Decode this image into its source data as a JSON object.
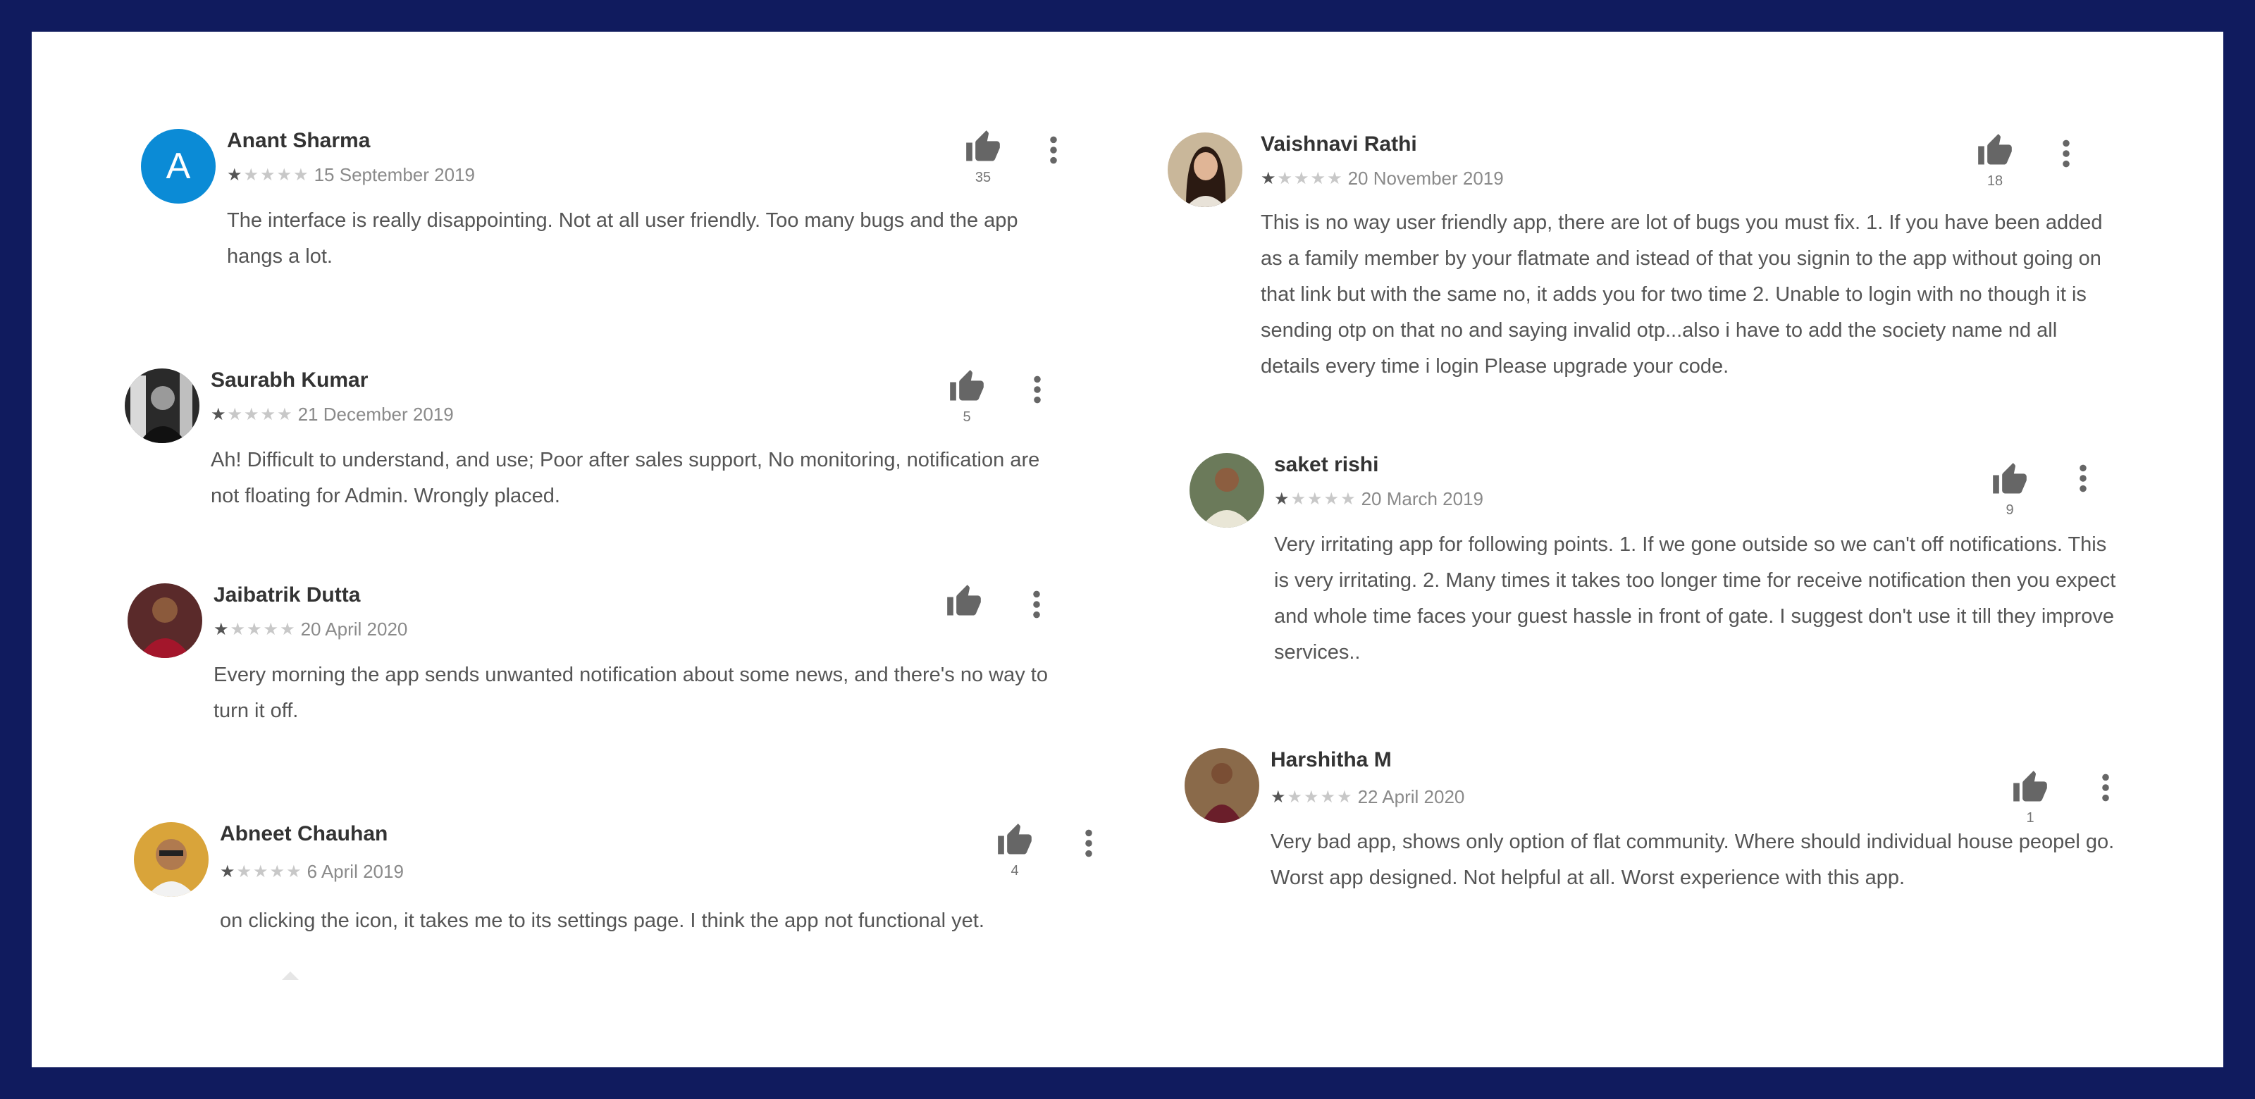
{
  "icons": {
    "like": "thumb-up-icon",
    "more": "more-vertical-icon",
    "star": "star-icon"
  },
  "colors": {
    "frame": "#101b5e",
    "avatar_initial_bg": "#0b8bd6",
    "star_filled": "#555555",
    "star_empty": "#c8c8c8"
  },
  "reviews": [
    {
      "author": "Anant Sharma",
      "avatar_initial": "A",
      "rating": 1,
      "stars_text": {
        "filled": "★",
        "empty": "★★★★"
      },
      "date": "15 September 2019",
      "text": "The interface is really disappointing. Not at all user friendly. Too many bugs and the app hangs a lot.",
      "likes": "35"
    },
    {
      "author": "Saurabh Kumar",
      "rating": 1,
      "stars_text": {
        "filled": "★",
        "empty": "★★★★"
      },
      "date": "21 December 2019",
      "text": "Ah! Difficult to understand, and use; Poor after sales support, No monitoring, notification are not floating for Admin. Wrongly placed.",
      "likes": "5"
    },
    {
      "author": "Jaibatrik Dutta",
      "rating": 1,
      "stars_text": {
        "filled": "★",
        "empty": "★★★★"
      },
      "date": "20 April 2020",
      "text": "Every morning the app sends unwanted notification about some news, and there's no way to turn it off.",
      "likes": ""
    },
    {
      "author": "Abneet Chauhan",
      "rating": 1,
      "stars_text": {
        "filled": "★",
        "empty": "★★★★"
      },
      "date": "6 April 2019",
      "text": "on clicking the icon, it takes me to its settings page. I think the app not functional yet.",
      "likes": "4"
    },
    {
      "author": "Vaishnavi Rathi",
      "rating": 1,
      "stars_text": {
        "filled": "★",
        "empty": "★★★★"
      },
      "date": "20 November 2019",
      "text": "This is no way user friendly app, there are lot of bugs you must fix. 1. If you have been added as a family member by your flatmate and istead of that you signin to the app without going on that link but with the same no, it adds you for two time 2. Unable to login with no though it is sending otp on that no and saying invalid otp...also i have to add the society name nd all details every time i login Please upgrade your code.",
      "likes": "18"
    },
    {
      "author": "saket rishi",
      "rating": 1,
      "stars_text": {
        "filled": "★",
        "empty": "★★★★"
      },
      "date": "20 March 2019",
      "text": "Very irritating app for following points. 1. If we gone outside so we can't off notifications. This is very irritating. 2. Many times it takes too longer time for receive notification then you expect and whole time faces your guest hassle in front of gate. I suggest don't use it till they improve services..",
      "likes": "9"
    },
    {
      "author": "Harshitha M",
      "rating": 1,
      "stars_text": {
        "filled": "★",
        "empty": "★★★★"
      },
      "date": "22 April 2020",
      "text": "Very bad app, shows only option of flat community. Where should individual house peopel go. Worst app designed. Not helpful at all. Worst experience with this app.",
      "likes": "1"
    }
  ]
}
